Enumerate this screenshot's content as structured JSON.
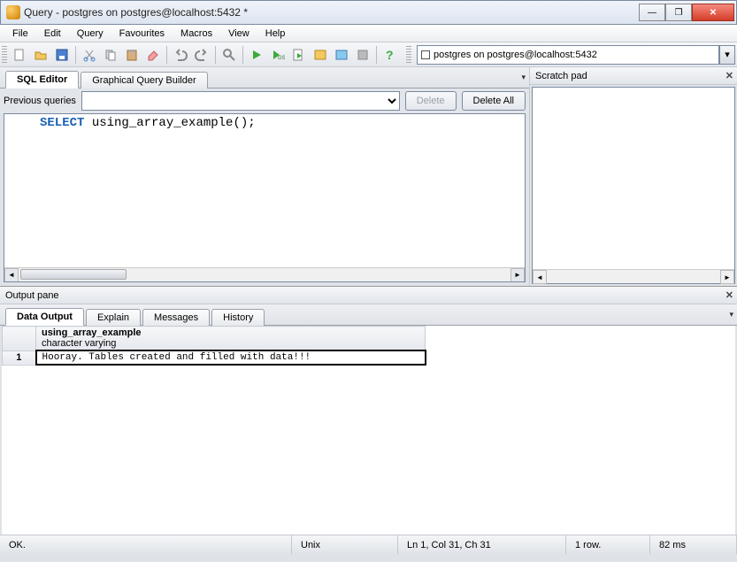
{
  "window": {
    "title": "Query - postgres on postgres@localhost:5432 *"
  },
  "menu": {
    "file": "File",
    "edit": "Edit",
    "query": "Query",
    "favourites": "Favourites",
    "macros": "Macros",
    "view": "View",
    "help": "Help"
  },
  "connection": {
    "label": "postgres on postgres@localhost:5432"
  },
  "tabs": {
    "sql_editor": "SQL Editor",
    "gqb": "Graphical Query Builder"
  },
  "prev_queries": {
    "label": "Previous queries",
    "delete": "Delete",
    "delete_all": "Delete All"
  },
  "sql": {
    "keyword": "SELECT",
    "rest": " using_array_example();"
  },
  "scratch": {
    "title": "Scratch pad"
  },
  "output": {
    "pane_title": "Output pane",
    "tabs": {
      "data": "Data Output",
      "explain": "Explain",
      "messages": "Messages",
      "history": "History"
    },
    "col_name": "using_array_example",
    "col_type": "character varying",
    "rownum": "1",
    "value": "Hooray. Tables created and filled with data!!!"
  },
  "status": {
    "ok": "OK.",
    "enc": "Unix",
    "pos": "Ln 1, Col 31, Ch 31",
    "rows": "1 row.",
    "time": "82 ms"
  }
}
